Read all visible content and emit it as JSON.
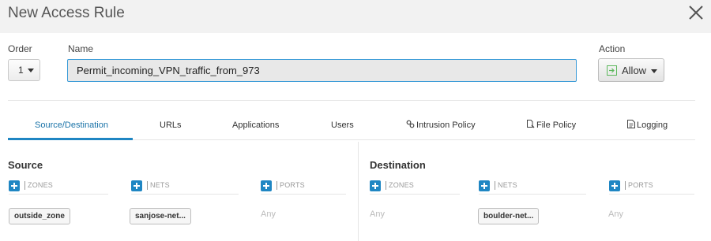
{
  "dialog": {
    "title": "New Access Rule"
  },
  "form": {
    "order_label": "Order",
    "order_value": "1",
    "name_label": "Name",
    "name_value": "Permit_incoming_VPN_traffic_from_973",
    "action_label": "Action",
    "action_value": "Allow"
  },
  "tabs": [
    {
      "label": "Source/Destination",
      "active": true,
      "icon": ""
    },
    {
      "label": "URLs",
      "active": false,
      "icon": ""
    },
    {
      "label": "Applications",
      "active": false,
      "icon": ""
    },
    {
      "label": "Users",
      "active": false,
      "icon": ""
    },
    {
      "label": "Intrusion Policy",
      "active": false,
      "icon": "intrusion-policy-icon"
    },
    {
      "label": "File Policy",
      "active": false,
      "icon": "file-policy-icon"
    },
    {
      "label": "Logging",
      "active": false,
      "icon": "logging-icon"
    }
  ],
  "source": {
    "title": "Source",
    "zones_header": "ZONES",
    "nets_header": "NETS",
    "ports_header": "PORTS",
    "zones_item": "outside_zone",
    "nets_item": "sanjose-net...",
    "ports_placeholder": "Any"
  },
  "destination": {
    "title": "Destination",
    "zones_header": "ZONES",
    "nets_header": "NETS",
    "ports_header": "PORTS",
    "zones_placeholder": "Any",
    "nets_item": "boulder-net...",
    "ports_placeholder": "Any"
  },
  "colors": {
    "accent": "#1f86c3",
    "allow_icon": "#5cb85c",
    "input_border": "#3c9cd8"
  }
}
